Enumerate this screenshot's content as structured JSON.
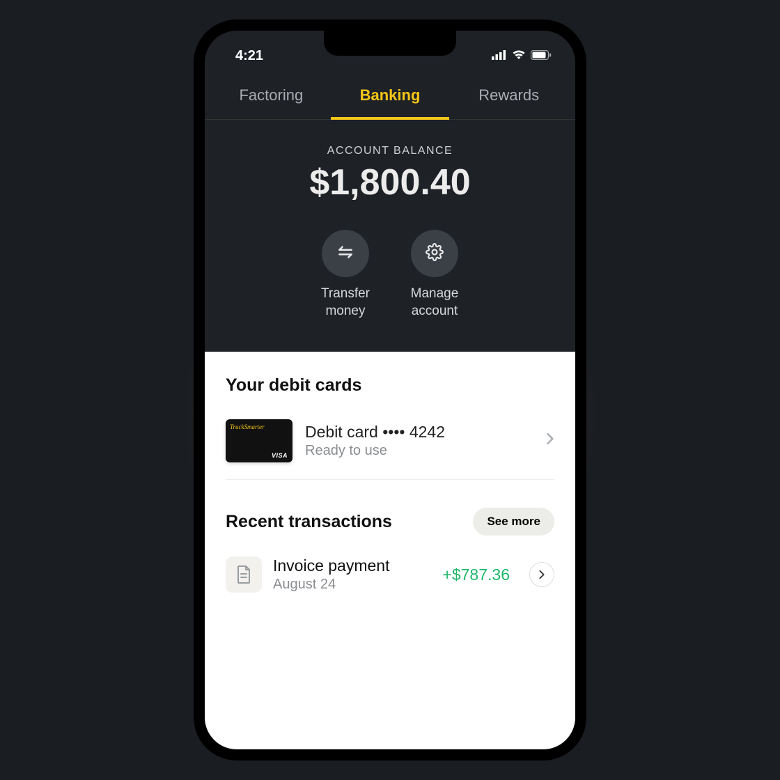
{
  "statusbar": {
    "time": "4:21"
  },
  "tabs": [
    {
      "label": "Factoring",
      "active": false
    },
    {
      "label": "Banking",
      "active": true
    },
    {
      "label": "Rewards",
      "active": false
    }
  ],
  "balance": {
    "label": "ACCOUNT BALANCE",
    "amount": "$1,800.40"
  },
  "actions": {
    "transfer": {
      "label": "Transfer\nmoney"
    },
    "manage": {
      "label": "Manage\naccount"
    }
  },
  "cards": {
    "section_title": "Your debit cards",
    "card": {
      "brand": "TruckSmarter",
      "network": "VISA",
      "title": "Debit card •••• 4242",
      "status": "Ready to use"
    }
  },
  "transactions": {
    "section_title": "Recent transactions",
    "see_more": "See more",
    "items": [
      {
        "title": "Invoice payment",
        "date": "August 24",
        "amount": "+$787.36"
      }
    ]
  }
}
